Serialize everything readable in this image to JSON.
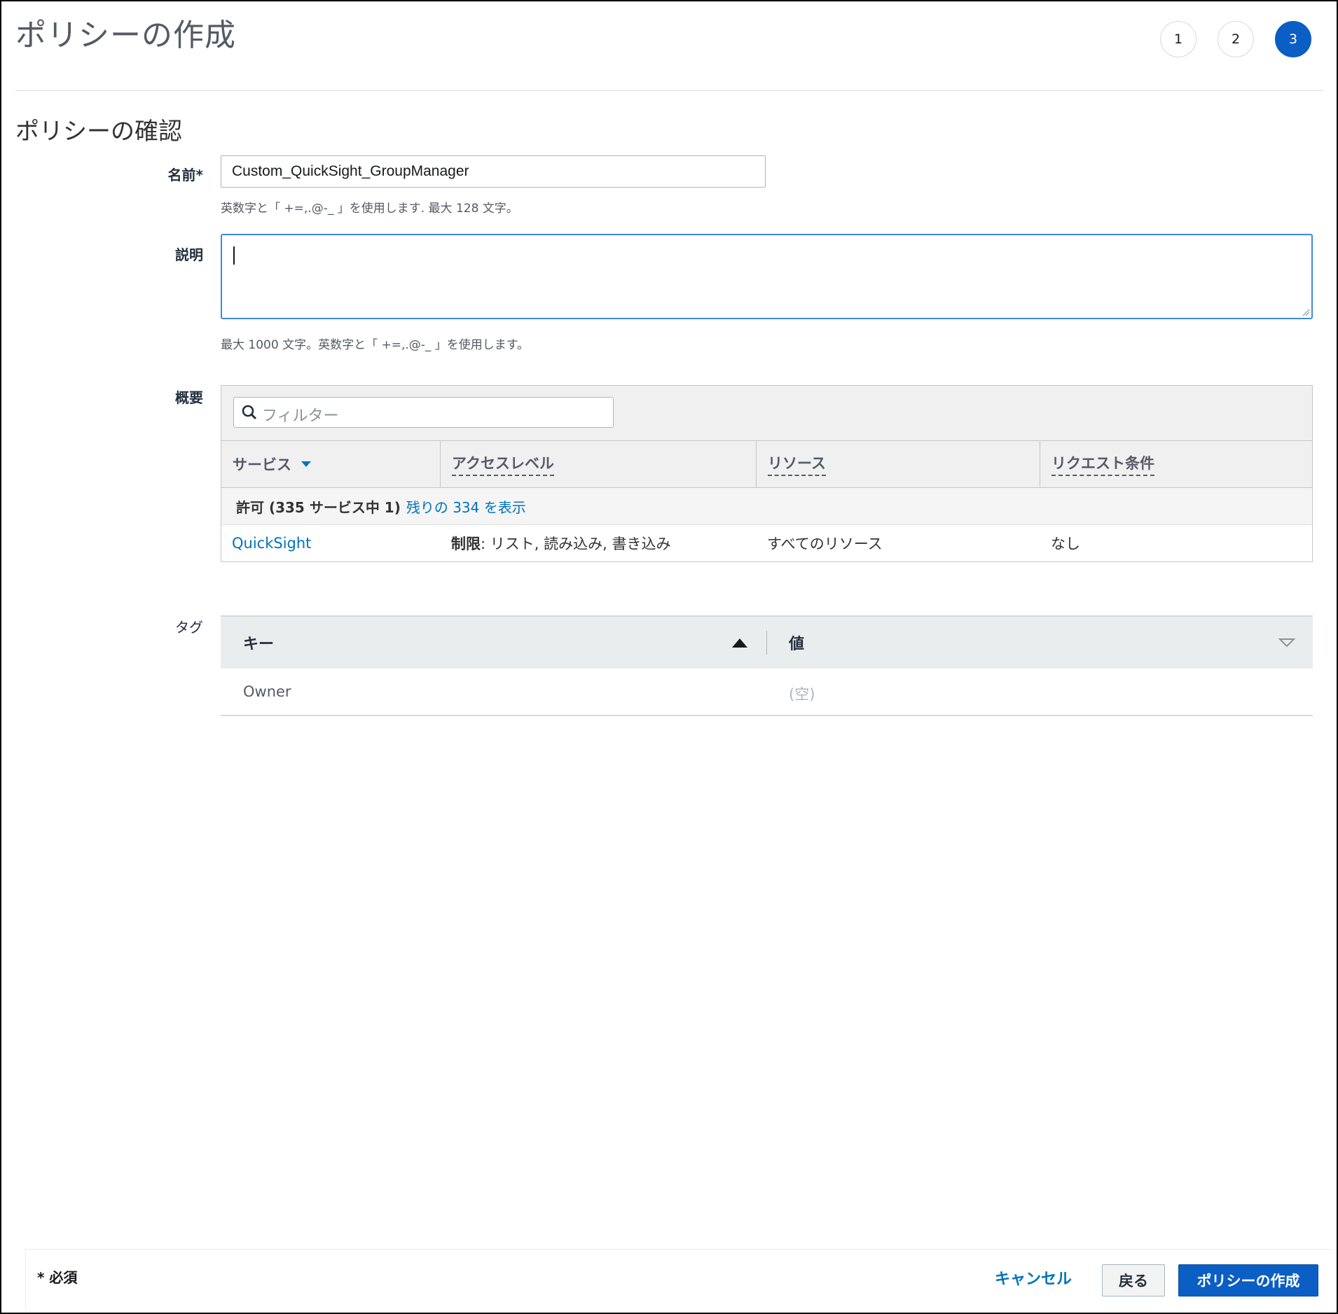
{
  "page_title": "ポリシーの作成",
  "steps": [
    "1",
    "2",
    "3"
  ],
  "active_step": 3,
  "section_title": "ポリシーの確認",
  "form": {
    "name_label": "名前*",
    "name_value": "Custom_QuickSight_GroupManager",
    "name_hint": "英数字と「 +=,.@-_ 」を使用します. 最大 128 文字。",
    "description_label": "説明",
    "description_value": "",
    "description_hint": "最大 1000 文字。英数字と「 +=,.@-_ 」を使用します。",
    "summary_label": "概要",
    "tags_label": "タグ"
  },
  "summary": {
    "filter_placeholder": "フィルター",
    "columns": [
      "サービス",
      "アクセスレベル",
      "リソース",
      "リクエスト条件"
    ],
    "group_label": "許可 (335 サービス中 1)",
    "group_link": "残りの 334 を表示",
    "rows": [
      {
        "service": "QuickSight",
        "access_prefix": "制限",
        "access_rest": ": リスト, 読み込み, 書き込み",
        "resource": "すべてのリソース",
        "condition": "なし"
      }
    ]
  },
  "tags": {
    "key_header": "キー",
    "value_header": "値",
    "rows": [
      {
        "key": "Owner",
        "value": "(空)"
      }
    ]
  },
  "footer": {
    "required_note": "* 必須",
    "cancel_label": "キャンセル",
    "back_label": "戻る",
    "create_label": "ポリシーの作成"
  },
  "colors": {
    "primary": "#0b5ec4",
    "link": "#0073bb",
    "focus_border": "#3f8ae0"
  }
}
